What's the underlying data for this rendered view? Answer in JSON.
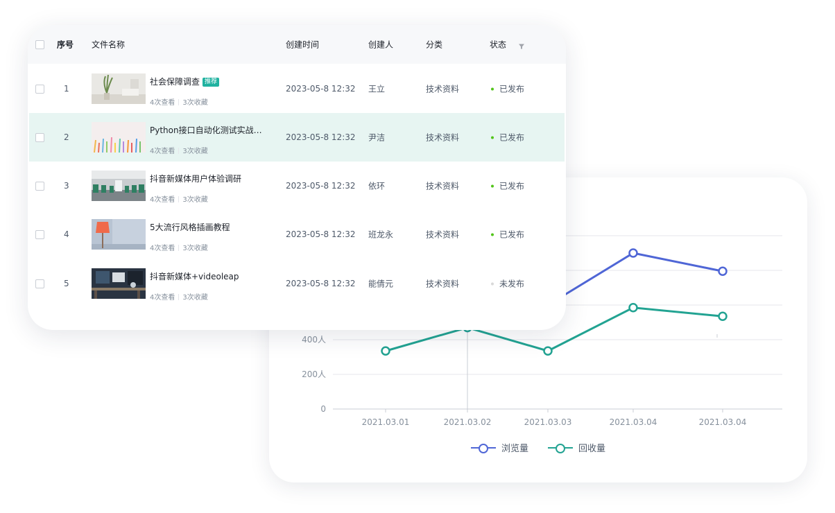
{
  "table": {
    "headers": {
      "seq": "序号",
      "file_name": "文件名称",
      "created_time": "创建时间",
      "creator": "创建人",
      "category": "分类",
      "status": "状态"
    },
    "rows": [
      {
        "seq": "1",
        "title": "社会保障调查",
        "badge": "推荐",
        "views": "4次查看",
        "favorites": "3次收藏",
        "time": "2023-05-8 12:32",
        "creator": "王立",
        "category": "技术资料",
        "status": "已发布",
        "status_color": "#52c41a",
        "thumb": "plant-room"
      },
      {
        "seq": "2",
        "title": "Python接口自动化测试实战调…",
        "badge": "",
        "views": "4次查看",
        "favorites": "3次收藏",
        "time": "2023-05-8 12:32",
        "creator": "尹洁",
        "category": "技术资料",
        "status": "已发布",
        "status_color": "#52c41a",
        "thumb": "pencils"
      },
      {
        "seq": "3",
        "title": "抖音新媒体用户体验调研",
        "badge": "",
        "views": "4次查看",
        "favorites": "3次收藏",
        "time": "2023-05-8 12:32",
        "creator": "依环",
        "category": "技术资料",
        "status": "已发布",
        "status_color": "#52c41a",
        "thumb": "office"
      },
      {
        "seq": "4",
        "title": "5大流行风格插画教程",
        "badge": "",
        "views": "4次查看",
        "favorites": "3次收藏",
        "time": "2023-05-8 12:32",
        "creator": "班龙永",
        "category": "技术资料",
        "status": "已发布",
        "status_color": "#52c41a",
        "thumb": "lamp"
      },
      {
        "seq": "5",
        "title": "抖音新媒体+videoleap",
        "badge": "",
        "views": "4次查看",
        "favorites": "3次收藏",
        "time": "2023-05-8 12:32",
        "creator": "能倩元",
        "category": "技术资料",
        "status": "未发布",
        "status_color": "#d9d9d9",
        "thumb": "desk"
      }
    ]
  },
  "chart_data": {
    "type": "line",
    "categories": [
      "2021.03.01",
      "2021.03.02",
      "2021.03.03",
      "2021.03.04",
      "2021.03.04"
    ],
    "y_tick_labels": [
      "0",
      "200人",
      "400人"
    ],
    "ylim": [
      0,
      1000
    ],
    "grid": true,
    "legend_position": "bottom",
    "series": [
      {
        "name": "浏览量",
        "color": "#4f66d6",
        "values": [
          null,
          470,
          600,
          900,
          795
        ]
      },
      {
        "name": "回收量",
        "color": "#22a392",
        "values": [
          335,
          470,
          335,
          585,
          535
        ]
      }
    ]
  }
}
